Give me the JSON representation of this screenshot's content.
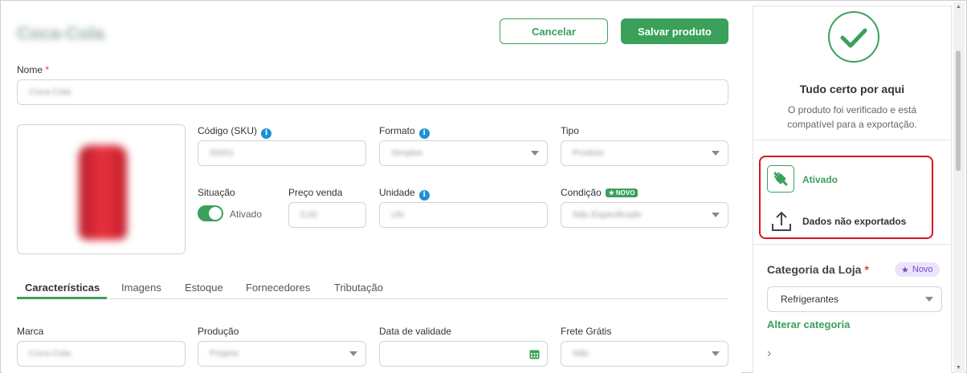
{
  "header": {
    "product_title": "Coca-Cola",
    "cancel_label": "Cancelar",
    "save_label": "Salvar produto"
  },
  "form": {
    "name_label": "Nome",
    "name_value": "Coca-Cola",
    "sku_label": "Código (SKU)",
    "sku_value": "00001",
    "format_label": "Formato",
    "format_value": "Simples",
    "type_label": "Tipo",
    "type_value": "Produto",
    "situation_label": "Situação",
    "situation_state": "Ativado",
    "price_label": "Preço venda",
    "price_value": "0,00",
    "unit_label": "Unidade",
    "unit_value": "UN",
    "condition_label": "Condição",
    "condition_badge": "NOVO",
    "condition_value": "Não Especificado"
  },
  "tabs": [
    {
      "label": "Características",
      "active": true
    },
    {
      "label": "Imagens"
    },
    {
      "label": "Estoque"
    },
    {
      "label": "Fornecedores"
    },
    {
      "label": "Tributação"
    }
  ],
  "characteristics": {
    "brand_label": "Marca",
    "brand_value": "Coca-Cola",
    "production_label": "Produção",
    "production_value": "Própria",
    "expiry_label": "Data de validade",
    "expiry_value": "",
    "shipping_label": "Frete Grátis",
    "shipping_value": "Não"
  },
  "side": {
    "status_title": "Tudo certo por aqui",
    "status_desc": "O produto foi verificado e está compatível para a exportação.",
    "enabled_label": "Ativado",
    "export_label": "Dados não exportados",
    "category_title": "Categoria da Loja",
    "category_badge": "Novo",
    "category_value": "Refrigerantes",
    "change_category": "Alterar categoria"
  },
  "colors": {
    "accent": "#3aa05a",
    "highlight": "#d9141f",
    "info": "#1f8fd6",
    "badge_purple": "#7447c9"
  }
}
